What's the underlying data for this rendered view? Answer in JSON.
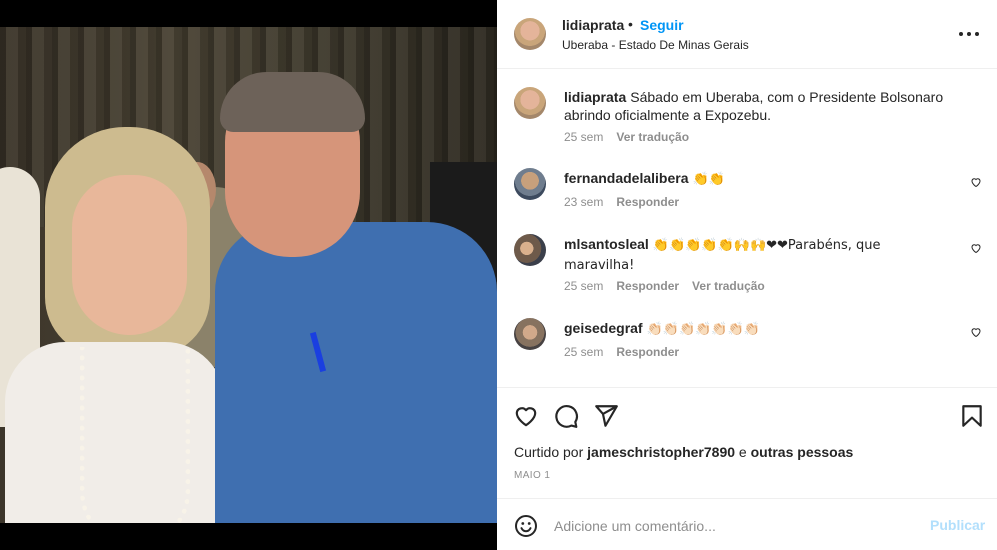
{
  "post": {
    "author": "lidiaprata",
    "separator": "•",
    "follow_label": "Seguir",
    "location": "Uberaba - Estado De Minas Gerais",
    "more_icon": "more-horizontal-icon"
  },
  "caption": {
    "username": "lidiaprata",
    "text": "Sábado em Uberaba, com o Presidente Bolsonaro abrindo oficialmente a Expozebu.",
    "time": "25 sem",
    "translate": "Ver tradução"
  },
  "comments": [
    {
      "username": "fernandadelalibera",
      "text": "👏👏",
      "time": "23 sem",
      "reply": "Responder",
      "translate": ""
    },
    {
      "username": "mlsantosleal",
      "text": "👏👏👏👏👏🙌🙌❤❤Parabéns, que maravilha!",
      "time": "25 sem",
      "reply": "Responder",
      "translate": "Ver tradução"
    },
    {
      "username": "geisedegraf",
      "text": "👏🏻👏🏻👏🏻👏🏻👏🏻👏🏻👏🏻",
      "time": "25 sem",
      "reply": "Responder",
      "translate": ""
    }
  ],
  "likes": {
    "prefix": "Curtido por",
    "user": "jameschristopher7890",
    "conjunction": "e",
    "others": "outras pessoas"
  },
  "date": "MAIO 1",
  "add_comment": {
    "placeholder": "Adicione um comentário...",
    "publish_label": "Publicar"
  },
  "colors": {
    "accent": "#0095f6",
    "publish_disabled": "#b2dffc",
    "secondary_text": "#8e8e8e"
  }
}
